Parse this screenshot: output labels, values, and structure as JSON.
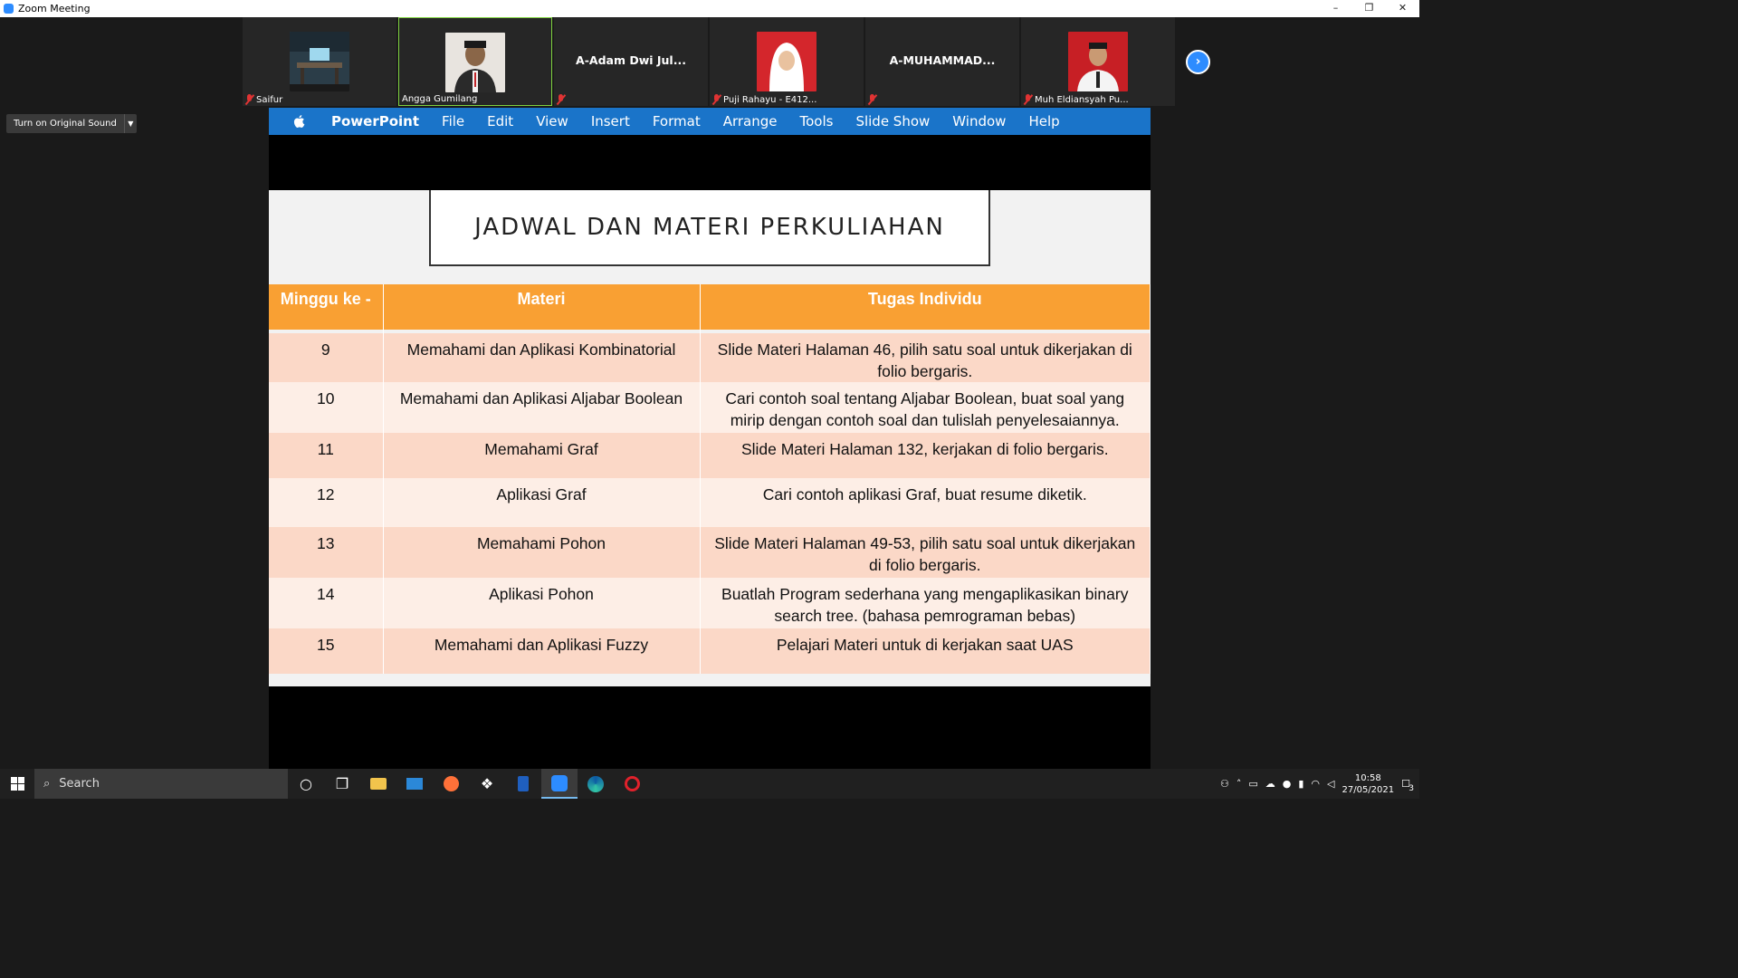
{
  "window": {
    "title": "Zoom Meeting",
    "minimize": "–",
    "restore": "❐",
    "close": "✕"
  },
  "participants": [
    {
      "name": "Saifur",
      "muted": true,
      "has_video": true
    },
    {
      "name": "Angga Gumilang",
      "muted": false,
      "has_video": true,
      "active_speaker": true
    },
    {
      "name": "A-Adam Dwi Jul...",
      "muted": true,
      "has_video": false
    },
    {
      "name": "Puji Rahayu - E412...",
      "muted": true,
      "has_video": true
    },
    {
      "name": "A-MUHAMMAD...",
      "muted": true,
      "has_video": false
    },
    {
      "name": "Muh Eldiansyah Pu...",
      "muted": true,
      "has_video": true
    }
  ],
  "next_page_icon": "chevron-right-icon",
  "original_sound": {
    "label": "Turn on Original Sound"
  },
  "menubar": {
    "app": "PowerPoint",
    "items": [
      "File",
      "Edit",
      "View",
      "Insert",
      "Format",
      "Arrange",
      "Tools",
      "Slide Show",
      "Window",
      "Help"
    ]
  },
  "slide": {
    "title": "JADWAL DAN MATERI PERKULIAHAN",
    "columns": [
      "Minggu ke -",
      "Materi",
      "Tugas Individu"
    ],
    "rows": [
      {
        "week": "9",
        "materi": "Memahami dan Aplikasi Kombinatorial",
        "tugas": "Slide Materi Halaman 46, pilih satu soal untuk dikerjakan di folio bergaris."
      },
      {
        "week": "10",
        "materi": "Memahami dan Aplikasi Aljabar Boolean",
        "tugas": "Cari contoh soal tentang Aljabar Boolean, buat soal yang mirip dengan contoh soal dan tulislah penyelesaiannya."
      },
      {
        "week": "11",
        "materi": "Memahami Graf",
        "tugas": "Slide Materi Halaman 132, kerjakan di folio bergaris."
      },
      {
        "week": "12",
        "materi": "Aplikasi Graf",
        "tugas": "Cari contoh aplikasi Graf, buat resume diketik."
      },
      {
        "week": "13",
        "materi": "Memahami Pohon",
        "tugas": "Slide Materi Halaman 49-53, pilih satu soal untuk dikerjakan di folio bergaris."
      },
      {
        "week": "14",
        "materi": "Aplikasi Pohon",
        "tugas": "Buatlah Program sederhana yang mengaplikasikan binary search tree. (bahasa pemrograman bebas)"
      },
      {
        "week": "15",
        "materi": "Memahami dan Aplikasi Fuzzy",
        "tugas": "Pelajari Materi untuk di kerjakan saat UAS"
      }
    ]
  },
  "taskbar": {
    "search_placeholder": "Search",
    "time": "10:58",
    "date": "27/05/2021",
    "notification_count": "3",
    "pinned_icons": [
      "cortana-icon",
      "task-view-icon",
      "file-explorer-icon",
      "mail-icon",
      "firefox-icon",
      "dropbox-icon",
      "app-icon",
      "zoom-icon",
      "edge-icon",
      "red-app-icon"
    ]
  },
  "colors": {
    "zoom_blue": "#2d8cff",
    "menubar_blue": "#1a74c9",
    "table_header": "#f9a033",
    "row_odd": "#fbd8c7",
    "row_even": "#fdeee6",
    "active_border": "#7fd33f",
    "mute_red": "#e03333"
  }
}
